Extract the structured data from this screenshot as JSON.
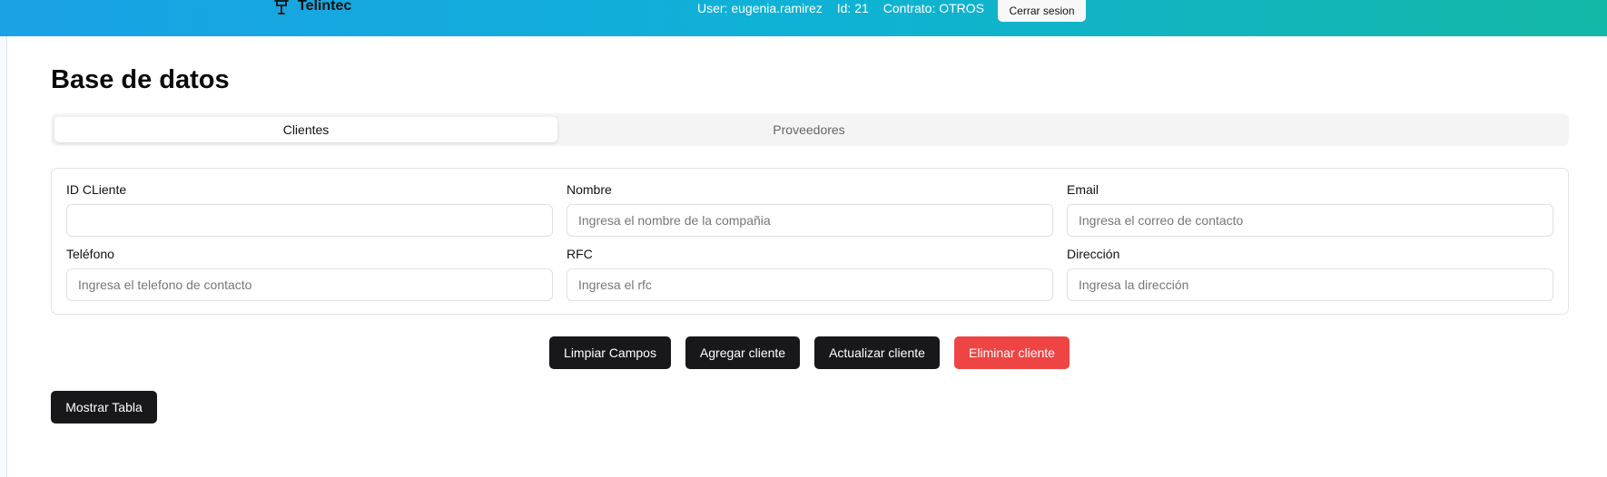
{
  "header": {
    "brand": "Telintec",
    "brand_icon": "tower-icon",
    "user": "User: eugenia.ramirez",
    "id": "Id: 21",
    "contract": "Contrato: OTROS",
    "logout_label": "Cerrar sesion",
    "gradient_colors": [
      "#1aa1e6",
      "#0fb2d6",
      "#14b8a6"
    ]
  },
  "page": {
    "title": "Base de datos"
  },
  "tabs": [
    {
      "label": "Clientes",
      "active": true
    },
    {
      "label": "Proveedores",
      "active": false
    }
  ],
  "form": {
    "id_cliente": {
      "label": "ID CLiente",
      "value": "",
      "placeholder": ""
    },
    "nombre": {
      "label": "Nombre",
      "value": "",
      "placeholder": "Ingresa el nombre de la compañia"
    },
    "email": {
      "label": "Email",
      "value": "",
      "placeholder": "Ingresa el correo de contacto"
    },
    "telefono": {
      "label": "Teléfono",
      "value": "",
      "placeholder": "Ingresa el telefono de contacto"
    },
    "rfc": {
      "label": "RFC",
      "value": "",
      "placeholder": "Ingresa el rfc"
    },
    "direccion": {
      "label": "Dirección",
      "value": "",
      "placeholder": "Ingresa la dirección"
    }
  },
  "actions": {
    "clear_label": "Limpiar Campos",
    "add_label": "Agregar cliente",
    "update_label": "Actualizar cliente",
    "delete_label": "Eliminar cliente",
    "show_table_label": "Mostrar Tabla",
    "danger_color": "#ef4444",
    "primary_color": "#18181b"
  }
}
